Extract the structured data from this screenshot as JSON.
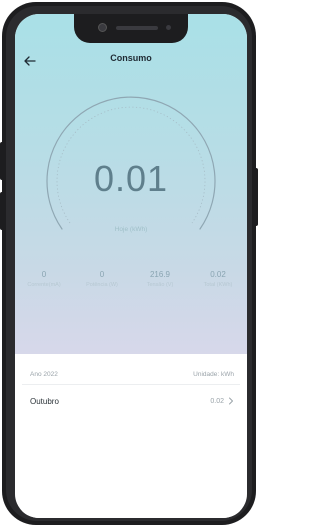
{
  "header": {
    "title": "Consumo"
  },
  "gauge": {
    "value": "0.01",
    "label": "Hoje (kWh)",
    "level": 0.0
  },
  "stats": [
    {
      "value": "0",
      "label": "Corrente(mA)"
    },
    {
      "value": "0",
      "label": "Potência (W)"
    },
    {
      "value": "216.9",
      "label": "Tensão (V)"
    },
    {
      "value": "0.02",
      "label": "Total (KWh)"
    }
  ],
  "history": {
    "year": "Ano 2022",
    "unit": "Unidade: kWh",
    "rows": [
      {
        "month": "Outubro",
        "value": "0.02"
      }
    ]
  },
  "colors": {
    "background_top": "#a9e0e7",
    "background_bottom": "#d7d8ea",
    "gauge_arc": "#8fa7b3",
    "value_text": "#5f7f8c"
  }
}
